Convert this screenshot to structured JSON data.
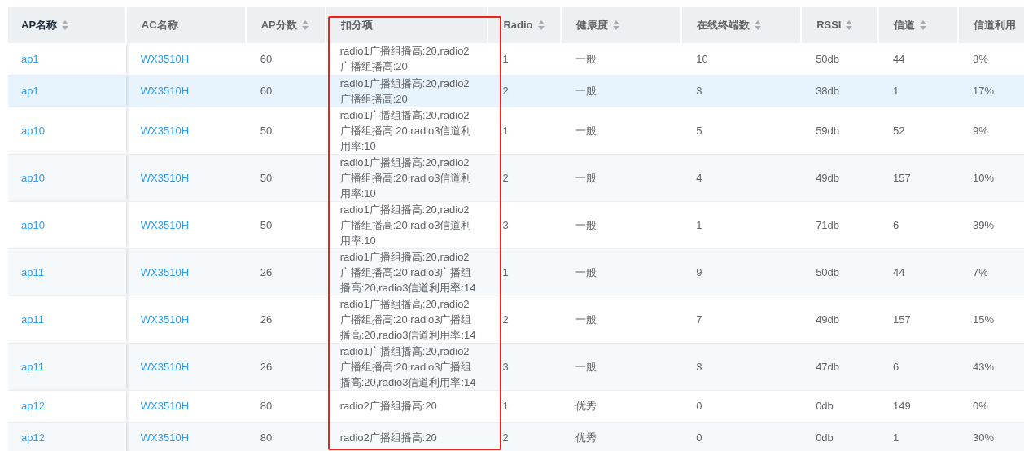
{
  "table": {
    "columns": [
      {
        "label": "AP名称",
        "sortable": true,
        "highlighted": false
      },
      {
        "label": "AC名称",
        "sortable": false,
        "highlighted": false
      },
      {
        "label": "AP分数",
        "sortable": true,
        "highlighted": false
      },
      {
        "label": "扣分项",
        "sortable": false,
        "highlighted": true
      },
      {
        "label": "Radio",
        "sortable": true,
        "highlighted": false
      },
      {
        "label": "健康度",
        "sortable": true,
        "highlighted": false
      },
      {
        "label": "在线终端数",
        "sortable": true,
        "highlighted": false
      },
      {
        "label": "RSSI",
        "sortable": true,
        "highlighted": false
      },
      {
        "label": "信道",
        "sortable": true,
        "highlighted": false
      },
      {
        "label": "信道利用",
        "sortable": false,
        "highlighted": false
      }
    ],
    "rows": [
      {
        "selected": false,
        "cells": [
          "ap1",
          "WX3510H",
          "60",
          "radio1广播组播高:20,radio2广播组播高:20",
          "1",
          "一般",
          "10",
          "50db",
          "44",
          "8%"
        ]
      },
      {
        "selected": true,
        "cells": [
          "ap1",
          "WX3510H",
          "60",
          "radio1广播组播高:20,radio2广播组播高:20",
          "2",
          "一般",
          "3",
          "38db",
          "1",
          "17%"
        ]
      },
      {
        "selected": false,
        "cells": [
          "ap10",
          "WX3510H",
          "50",
          "radio1广播组播高:20,radio2广播组播高:20,radio3信道利用率:10",
          "1",
          "一般",
          "5",
          "59db",
          "52",
          "9%"
        ]
      },
      {
        "selected": false,
        "cells": [
          "ap10",
          "WX3510H",
          "50",
          "radio1广播组播高:20,radio2广播组播高:20,radio3信道利用率:10",
          "2",
          "一般",
          "4",
          "49db",
          "157",
          "10%"
        ]
      },
      {
        "selected": false,
        "cells": [
          "ap10",
          "WX3510H",
          "50",
          "radio1广播组播高:20,radio2广播组播高:20,radio3信道利用率:10",
          "3",
          "一般",
          "1",
          "71db",
          "6",
          "39%"
        ]
      },
      {
        "selected": false,
        "cells": [
          "ap11",
          "WX3510H",
          "26",
          "radio1广播组播高:20,radio2广播组播高:20,radio3广播组播高:20,radio3信道利用率:14",
          "1",
          "一般",
          "9",
          "50db",
          "44",
          "7%"
        ]
      },
      {
        "selected": false,
        "cells": [
          "ap11",
          "WX3510H",
          "26",
          "radio1广播组播高:20,radio2广播组播高:20,radio3广播组播高:20,radio3信道利用率:14",
          "2",
          "一般",
          "7",
          "49db",
          "157",
          "15%"
        ]
      },
      {
        "selected": false,
        "cells": [
          "ap11",
          "WX3510H",
          "26",
          "radio1广播组播高:20,radio2广播组播高:20,radio3广播组播高:20,radio3信道利用率:14",
          "3",
          "一般",
          "3",
          "47db",
          "6",
          "43%"
        ]
      },
      {
        "selected": false,
        "cells": [
          "ap12",
          "WX3510H",
          "80",
          "radio2广播组播高:20",
          "1",
          "优秀",
          "0",
          "0db",
          "149",
          "0%"
        ]
      },
      {
        "selected": false,
        "cells": [
          "ap12",
          "WX3510H",
          "80",
          "radio2广播组播高:20",
          "2",
          "优秀",
          "0",
          "0db",
          "1",
          "30%"
        ]
      }
    ]
  }
}
